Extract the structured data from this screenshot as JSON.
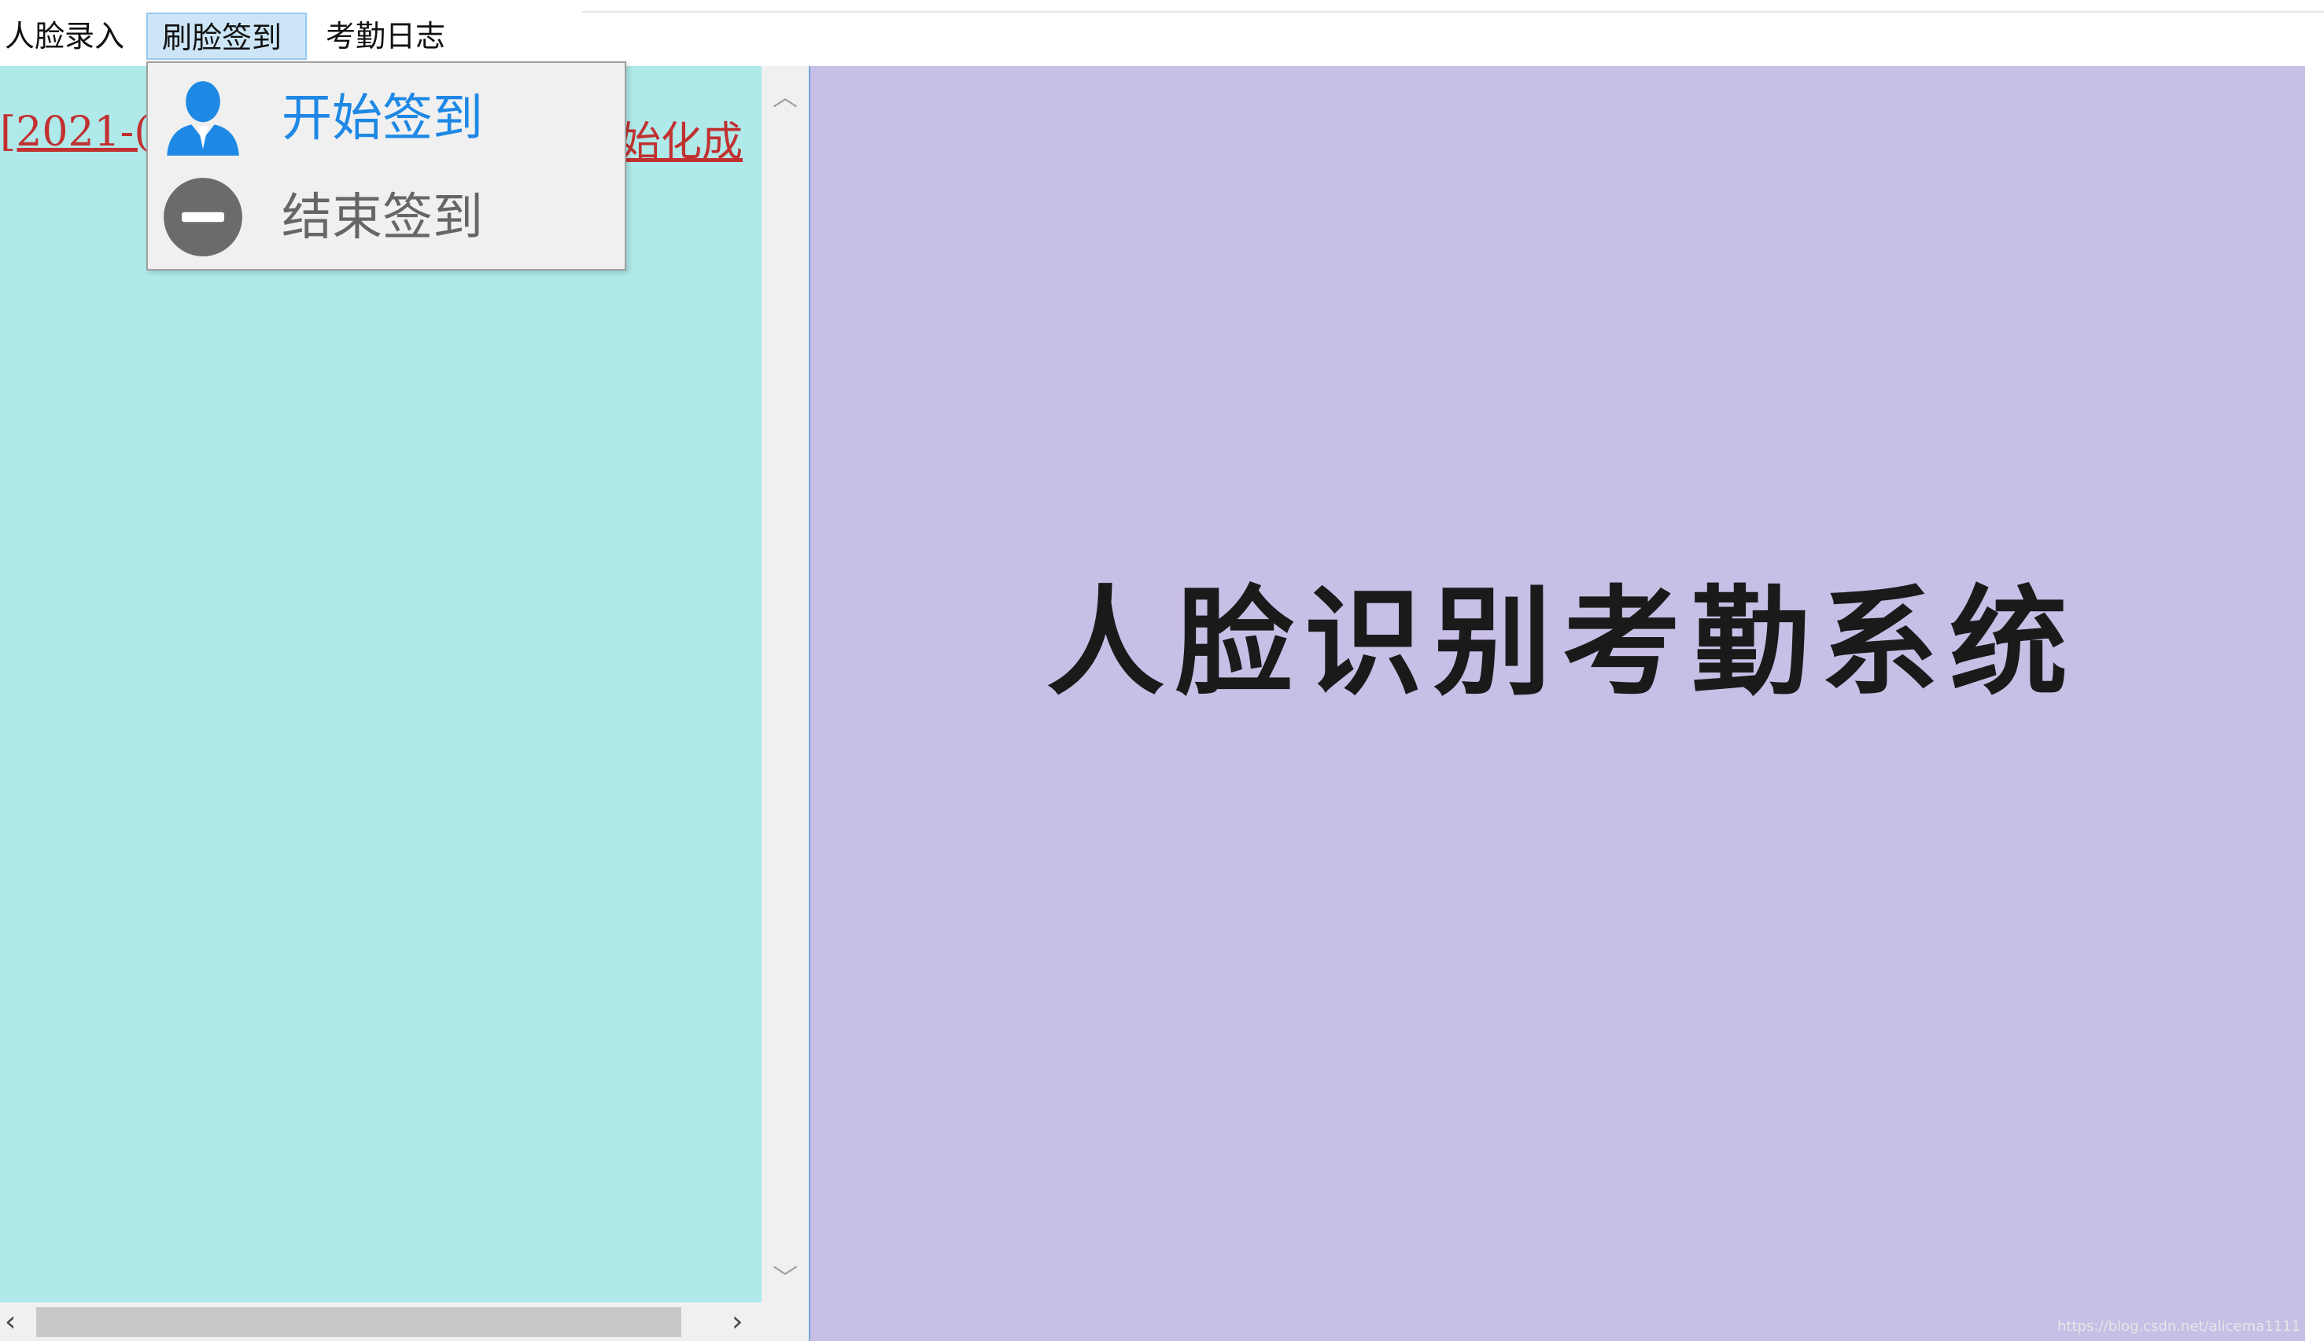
{
  "menubar": {
    "items": [
      "人脸录入",
      "刷脸签到",
      "考勤日志"
    ],
    "active_index": 1
  },
  "dropdown": {
    "items": [
      {
        "label": "开始签到",
        "icon": "user-icon",
        "color": "#1e88e5"
      },
      {
        "label": "结束签到",
        "icon": "minus-circle-icon",
        "color": "#666666"
      }
    ]
  },
  "log": {
    "line_start_visible": "[2021-(",
    "line_end_visible": "始化成"
  },
  "main": {
    "title": "人脸识别考勤系统",
    "background_color": "#c8bfe7"
  },
  "log_panel_color": "#afe9e9",
  "watermark": "https://blog.csdn.net/alicema1111"
}
